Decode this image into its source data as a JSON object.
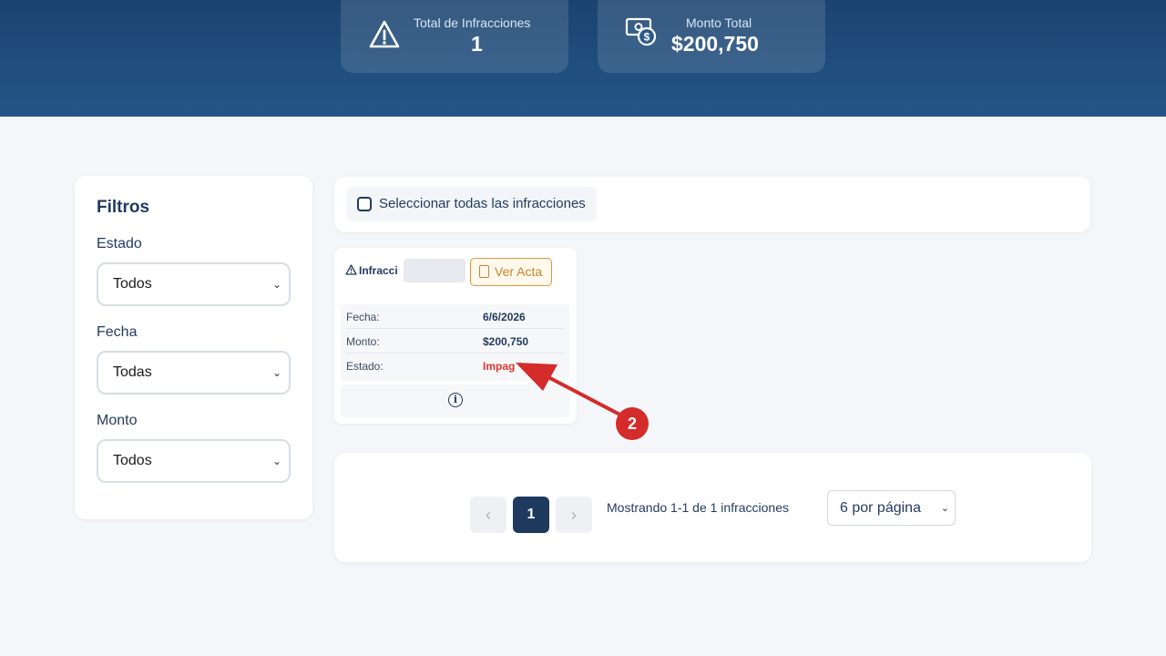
{
  "colors": {
    "header": "#1b4370",
    "primary": "#1f3a5f",
    "danger": "#e0382e",
    "accent": "#c4862b",
    "annotation": "#d42b2b"
  },
  "stats": {
    "total": {
      "label": "Total de Infracciones",
      "value": "1",
      "icon": "warning-icon"
    },
    "amount": {
      "label": "Monto Total",
      "value": "$200,750",
      "icon": "money-icon"
    }
  },
  "filters": {
    "title": "Filtros",
    "estado": {
      "label": "Estado",
      "value": "Todos"
    },
    "fecha": {
      "label": "Fecha",
      "value": "Todas"
    },
    "monto": {
      "label": "Monto",
      "value": "Todos"
    }
  },
  "select_all": {
    "label": "Seleccionar todas las infracciones"
  },
  "infraction": {
    "title": "Infracci",
    "view_button": "Ver Acta",
    "rows": [
      {
        "key": "Fecha:",
        "value": "6/6/2026"
      },
      {
        "key": "Monto:",
        "value": "$200,750"
      },
      {
        "key": "Estado:",
        "value": "Impag"
      }
    ]
  },
  "pagination": {
    "prev": "‹",
    "current": "1",
    "next": "›",
    "summary": "Mostrando 1-1 de 1 infracciones",
    "per_page": "6 por página"
  },
  "annotation": {
    "step": "2"
  }
}
